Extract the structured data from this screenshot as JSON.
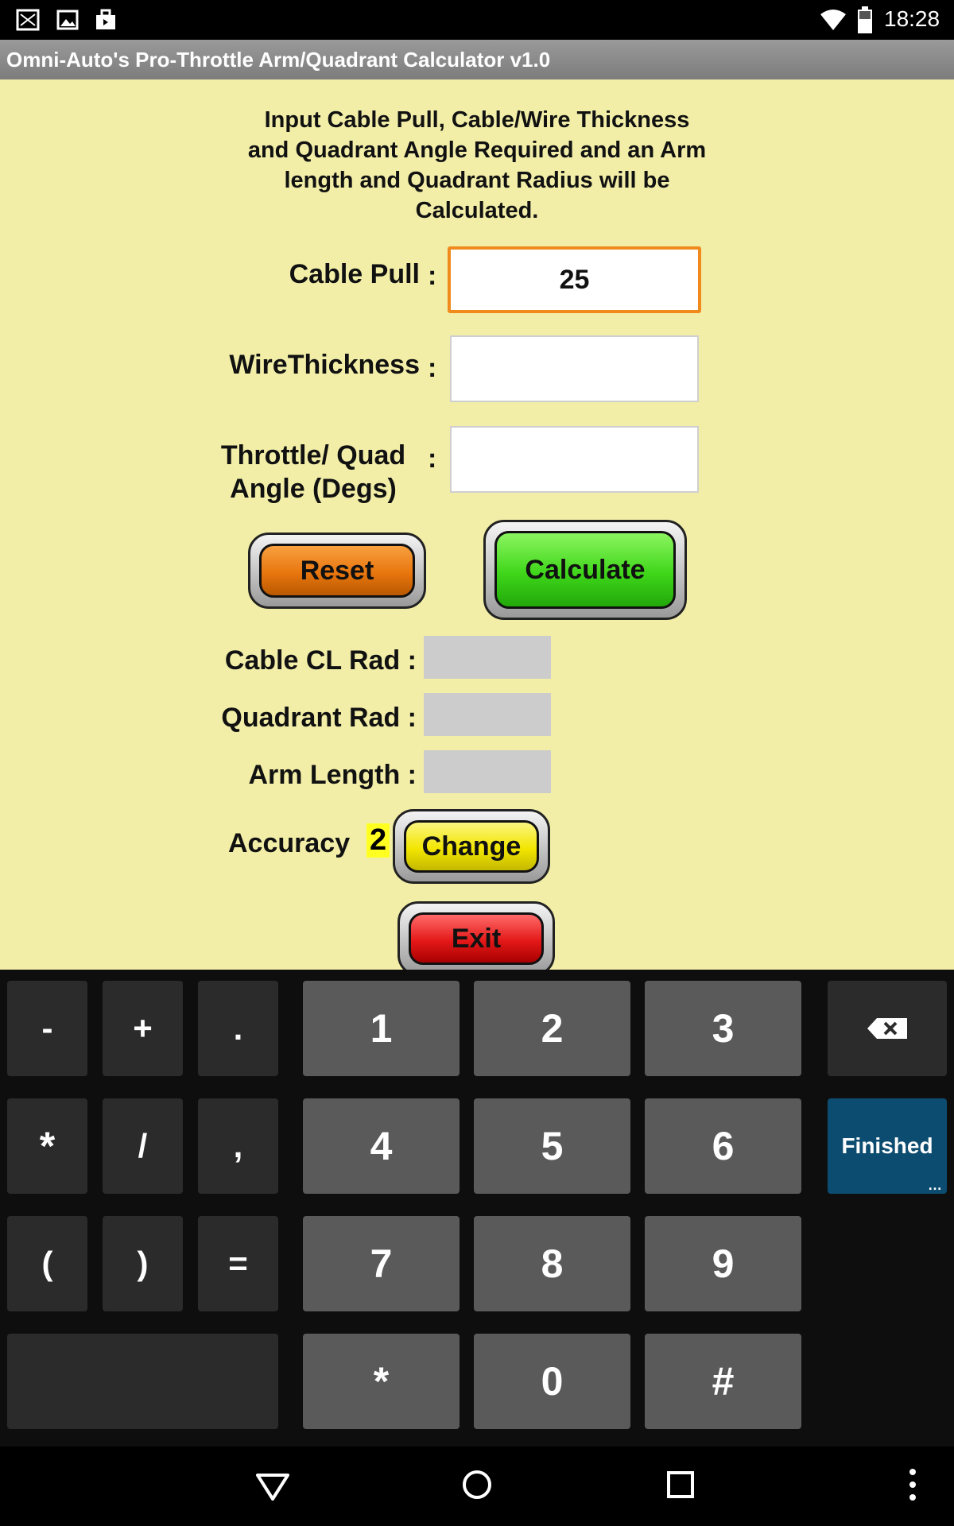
{
  "status_bar": {
    "time": "18:28",
    "icons": [
      "notification-icon",
      "image-icon",
      "briefcase-icon",
      "wifi-icon",
      "battery-icon"
    ]
  },
  "title_bar": {
    "title": "Omni-Auto's Pro-Throttle Arm/Quadrant Calculator v1.0"
  },
  "app": {
    "intro": "Input  Cable Pull,  Cable/Wire Thickness\nand Quadrant  Angle Required and an Arm\nlength and Quadrant Radius will be\nCalculated.",
    "inputs": {
      "cable_pull": {
        "label": "Cable Pull",
        "colon": ":",
        "value": "25"
      },
      "wire_thickness": {
        "label": "WireThickness",
        "colon": ":",
        "value": ""
      },
      "angle": {
        "label_line1": "Throttle/ Quad",
        "label_line2": "Angle (Degs)",
        "colon": ":",
        "value": ""
      }
    },
    "buttons": {
      "reset": "Reset",
      "calculate": "Calculate",
      "change": "Change",
      "exit": "Exit"
    },
    "outputs": {
      "cable_cl_rad": "Cable CL Rad :",
      "quadrant_rad": "Quadrant Rad :",
      "arm_length": "Arm Length :"
    },
    "accuracy": {
      "label": "Accuracy",
      "value": "2"
    },
    "colors": {
      "background": "#f2eea8",
      "reset": "#e8760e",
      "calculate": "#3fd61a",
      "change": "#f2e600",
      "exit": "#e41818"
    }
  },
  "keyboard": {
    "rows": [
      [
        "-",
        "+",
        ".",
        "1",
        "2",
        "3",
        "backspace"
      ],
      [
        "*",
        "/",
        ",",
        "4",
        "5",
        "6",
        "Finished"
      ],
      [
        "(",
        ")",
        "=",
        "7",
        "8",
        "9"
      ],
      [
        "",
        "*",
        "0",
        "#"
      ]
    ],
    "finished_label": "Finished",
    "finished_color": "#0c4c70"
  },
  "nav_bar": {
    "icons": [
      "back-icon",
      "home-icon",
      "recents-icon",
      "menu-icon"
    ]
  }
}
